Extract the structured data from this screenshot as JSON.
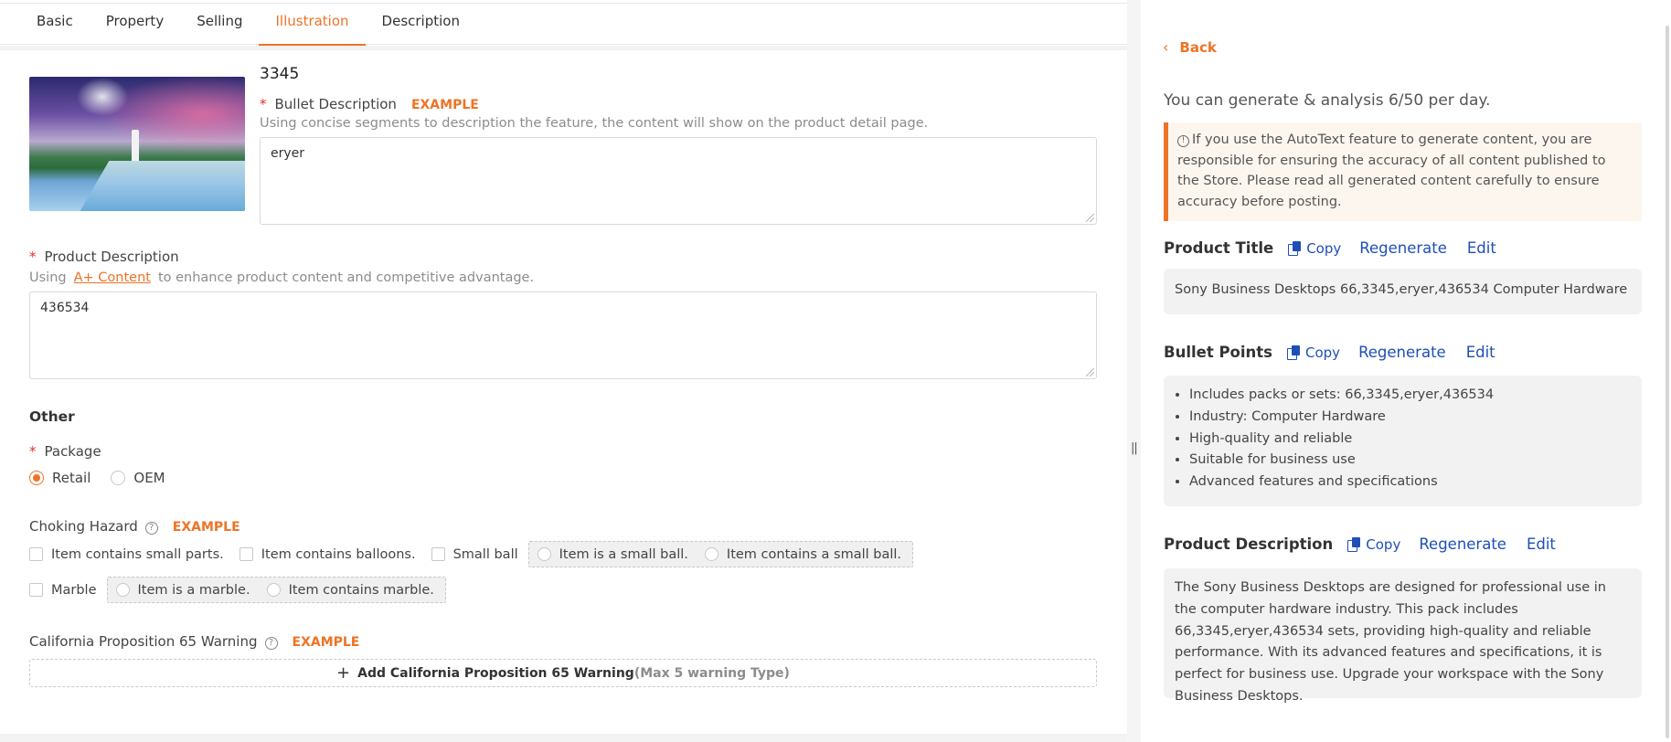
{
  "tabs": [
    {
      "label": "Basic"
    },
    {
      "label": "Property"
    },
    {
      "label": "Selling"
    },
    {
      "label": "Illustration"
    },
    {
      "label": "Description"
    }
  ],
  "item": {
    "title": "3345"
  },
  "bullet": {
    "label": "Bullet Description",
    "example": "EXAMPLE",
    "hint": "Using concise segments to description the feature, the content will show on the product detail page.",
    "value": "eryer"
  },
  "product_desc": {
    "label": "Product Description",
    "hint_pre": "Using",
    "hint_link": "A+ Content",
    "hint_post": "to enhance product content and competitive advantage.",
    "value": "436534"
  },
  "other": {
    "title": "Other"
  },
  "package": {
    "label": "Package",
    "options": [
      "Retail",
      "OEM"
    ],
    "selected": "Retail"
  },
  "choking": {
    "label": "Choking Hazard",
    "example": "EXAMPLE",
    "row1": [
      "Item contains small parts.",
      "Item contains balloons.",
      "Small ball"
    ],
    "row1_sub": [
      "Item is a small ball.",
      "Item contains a small ball."
    ],
    "row2": [
      "Marble"
    ],
    "row2_sub": [
      "Item is a marble.",
      "Item contains marble."
    ]
  },
  "prop65": {
    "label": "California Proposition 65 Warning",
    "example": "EXAMPLE",
    "add_label": "Add California Proposition 65 Warning",
    "add_max": "(Max 5 warning Type)"
  },
  "right": {
    "back": "Back",
    "quota": "You can generate & analysis 6/50 per day.",
    "notice": "If you use the AutoText feature to generate content, you are responsible for ensuring the accuracy of all content published to the Store. Please read all generated content carefully to ensure accuracy before posting.",
    "copy": "Copy",
    "regenerate": "Regenerate",
    "edit": "Edit",
    "product_title": {
      "heading": "Product Title",
      "text": "Sony Business Desktops 66,3345,eryer,436534 Computer Hardware"
    },
    "bullet_points": {
      "heading": "Bullet Points",
      "items": [
        "Includes packs or sets: 66,3345,eryer,436534",
        "Industry: Computer Hardware",
        "High-quality and reliable",
        "Suitable for business use",
        "Advanced features and specifications"
      ]
    },
    "product_description": {
      "heading": "Product Description",
      "text": "The Sony Business Desktops are designed for professional use in the computer hardware industry. This pack includes 66,3345,eryer,436534 sets, providing high-quality and reliable performance. With its advanced features and specifications, it is perfect for business use. Upgrade your workspace with the Sony Business Desktops."
    }
  },
  "colors": {
    "accent": "#ee7326",
    "link_blue": "#1e4fb8",
    "required": "#e0322b"
  }
}
